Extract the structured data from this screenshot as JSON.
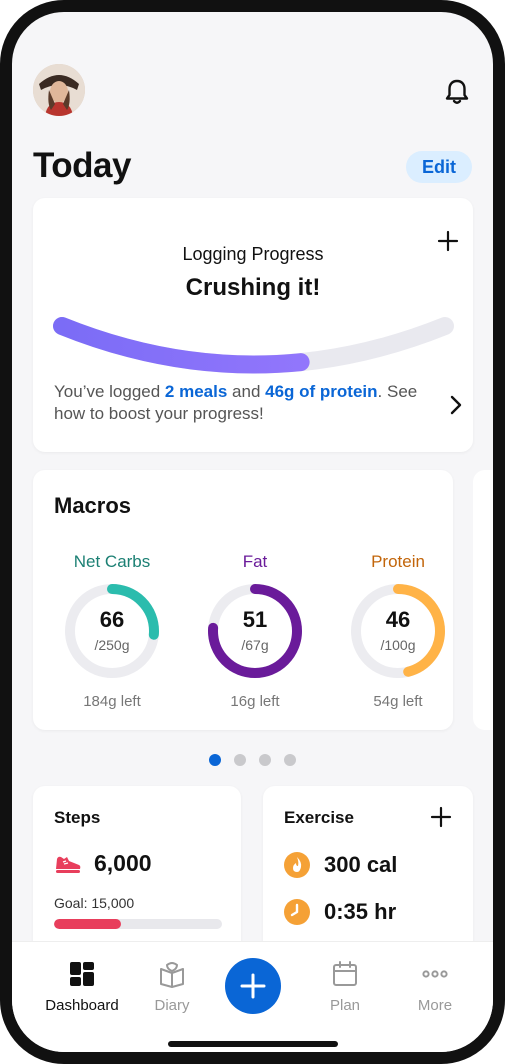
{
  "header": {
    "title": "Today",
    "edit_label": "Edit"
  },
  "progress": {
    "title": "Logging Progress",
    "status": "Crushing it!",
    "level": 0.62,
    "message_prefix": "You’ve logged ",
    "meals": "2 meals",
    "message_mid": " and ",
    "protein": "46g of protein",
    "message_suffix": ". See how to boost your progress!"
  },
  "macros": {
    "title": "Macros",
    "items": [
      {
        "name": "Net Carbs",
        "value": "66",
        "goal": "/250g",
        "left": "184g left",
        "fraction": 0.264,
        "color": "#2bbcad",
        "label_color": "#1c8074"
      },
      {
        "name": "Fat",
        "value": "51",
        "goal": "/67g",
        "left": "16g left",
        "fraction": 0.761,
        "color": "#6a1b9a",
        "label_color": "#6a1b9a"
      },
      {
        "name": "Protein",
        "value": "46",
        "goal": "/100g",
        "left": "54g left",
        "fraction": 0.46,
        "color": "#ffb347",
        "label_color": "#c2650a"
      }
    ],
    "pager": {
      "count": 4,
      "active": 0
    }
  },
  "steps": {
    "title": "Steps",
    "value": "6,000",
    "goal_text": "Goal: 15,000",
    "progress": 0.4,
    "color": "#e83e5c"
  },
  "exercise": {
    "title": "Exercise",
    "calories": "300 cal",
    "duration": "0:35 hr"
  },
  "tabs": [
    {
      "label": "Dashboard",
      "icon": "dashboard-icon",
      "active": true
    },
    {
      "label": "Diary",
      "icon": "diary-icon",
      "active": false
    },
    {
      "label": "Plan",
      "icon": "calendar-icon",
      "active": false
    },
    {
      "label": "More",
      "icon": "more-icon",
      "active": false
    }
  ],
  "colors": {
    "accent": "#0a66d6",
    "background": "#f6f6f8"
  }
}
